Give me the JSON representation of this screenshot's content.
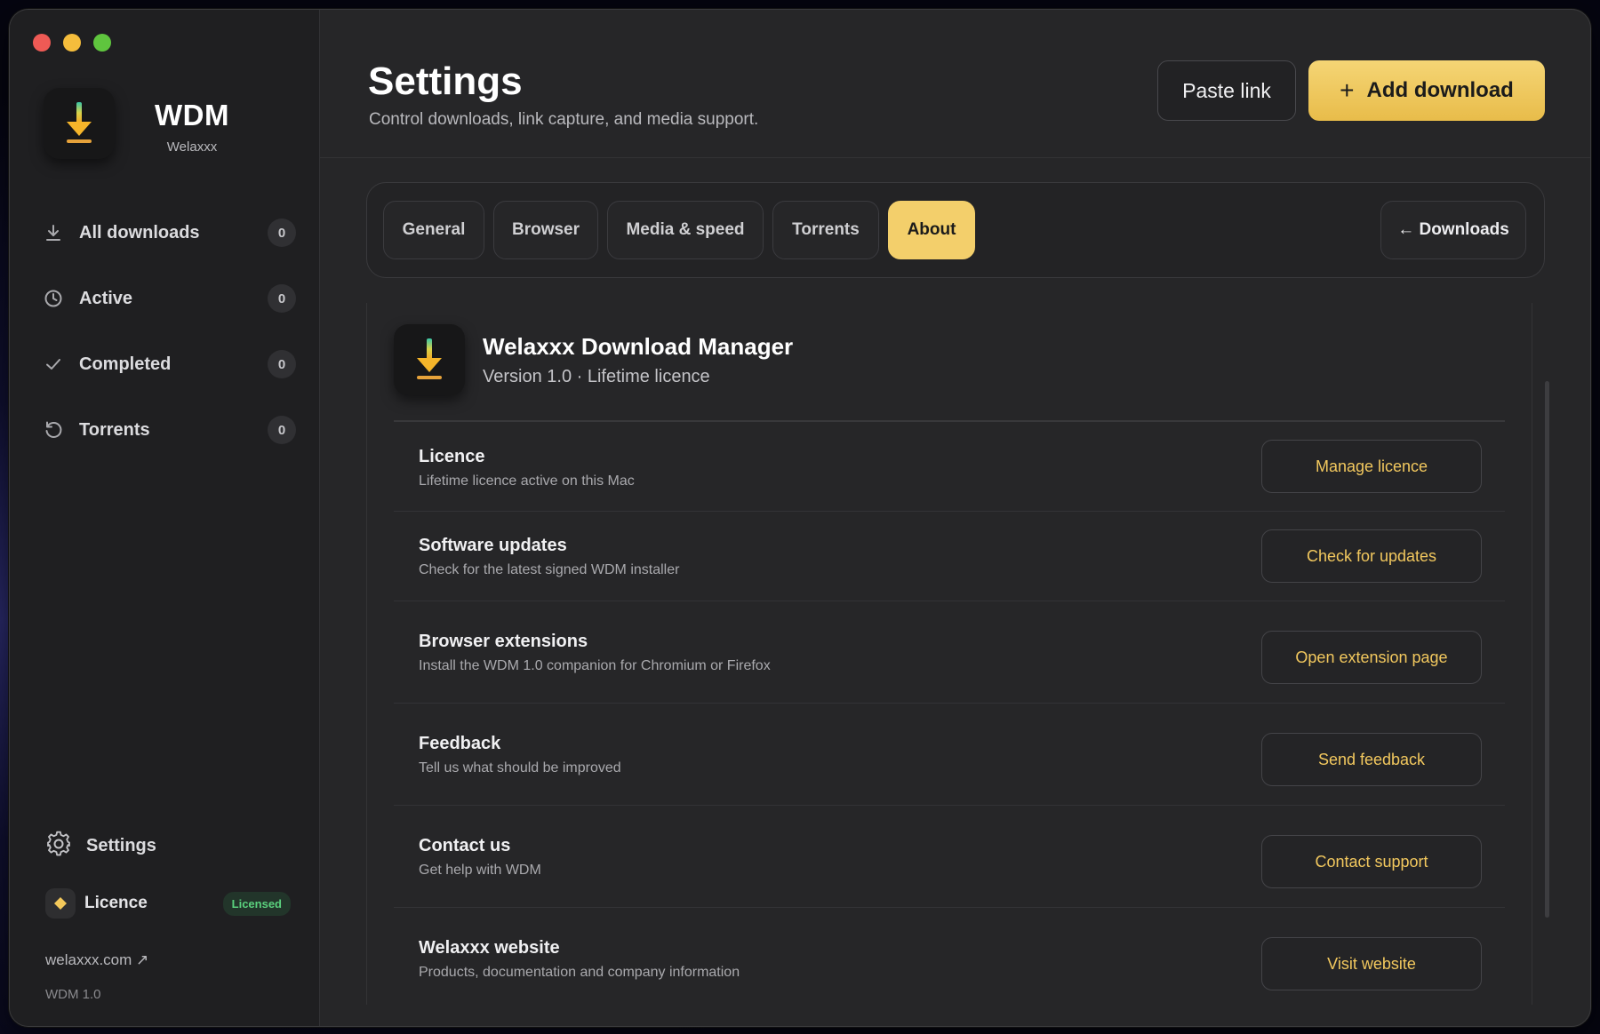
{
  "window": {
    "controls": [
      "close",
      "minimize",
      "zoom"
    ]
  },
  "sidebar": {
    "app_icon": "download-arrow-icon",
    "brand_title": "WDM",
    "brand_subtitle": "Welaxxx",
    "nav": [
      {
        "label": "All downloads",
        "count": "0",
        "icon": "download-icon"
      },
      {
        "label": "Active",
        "count": "0",
        "icon": "clock-icon"
      },
      {
        "label": "Completed",
        "count": "0",
        "icon": "check-icon"
      },
      {
        "label": "Torrents",
        "count": "0",
        "icon": "refresh-icon"
      }
    ],
    "settings_label": "Settings",
    "licence_label": "Licence",
    "licence_badge": "Licensed",
    "site_link": "welaxxx.com ↗",
    "version_footer": "WDM 1.0"
  },
  "header": {
    "title": "Settings",
    "subtitle": "Control downloads, link capture, and media support.",
    "paste_label": "Paste link",
    "add_label": "Add download",
    "add_icon": "+"
  },
  "tabs": {
    "items": [
      {
        "label": "General"
      },
      {
        "label": "Browser"
      },
      {
        "label": "Media & speed"
      },
      {
        "label": "Torrents"
      },
      {
        "label": "About"
      }
    ],
    "active": "About",
    "back_label": "← Downloads"
  },
  "about": {
    "app_name": "Welaxxx Download Manager",
    "version_line": "Version 1.0 · Lifetime licence",
    "rows": [
      {
        "title": "Licence",
        "desc": "Lifetime licence active on this Mac",
        "button": "Manage licence"
      },
      {
        "title": "Software updates",
        "desc": "Check for the latest signed WDM installer",
        "button": "Check for updates"
      },
      {
        "title": "Browser extensions",
        "desc": "Install the WDM 1.0 companion for Chromium or Firefox",
        "button": "Open extension page"
      },
      {
        "title": "Feedback",
        "desc": "Tell us what should be improved",
        "button": "Send feedback"
      },
      {
        "title": "Contact us",
        "desc": "Get help with WDM",
        "button": "Contact support"
      },
      {
        "title": "Welaxxx website",
        "desc": "Products, documentation and company information",
        "button": "Visit website"
      }
    ]
  },
  "colors": {
    "accent": "#f3cf6b",
    "licensed_badge": "#5ad07d",
    "window_bg": "#262628",
    "sidebar_bg": "#1f1f21"
  }
}
